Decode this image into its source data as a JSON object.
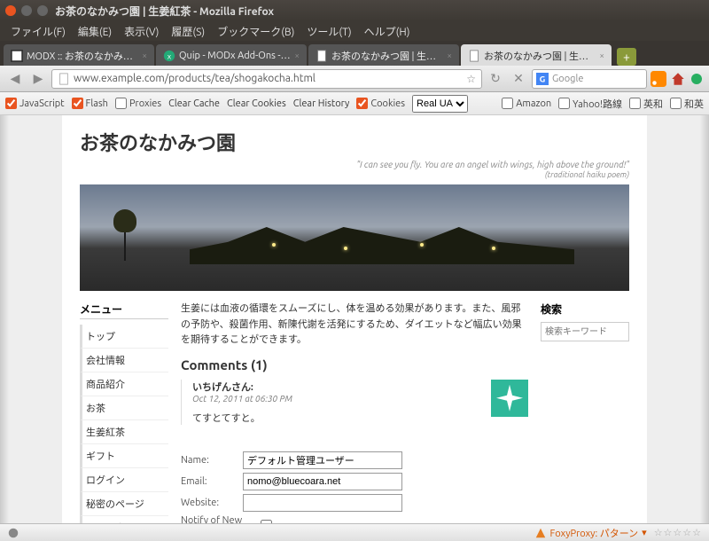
{
  "window": {
    "title": "お茶のなかみつ園 | 生姜紅茶 - Mozilla Firefox"
  },
  "menubar": {
    "file": "ファイル(F)",
    "edit": "編集(E)",
    "view": "表示(V)",
    "history": "履歴(S)",
    "bookmarks": "ブックマーク(B)",
    "tools": "ツール(T)",
    "help": "ヘルプ(H)"
  },
  "tabs": [
    {
      "label": "MODX :: お茶のなかみつ園"
    },
    {
      "label": "Quip - MODx Add-Ons - MO..."
    },
    {
      "label": "お茶のなかみつ園 | 生姜紅茶"
    },
    {
      "label": "お茶のなかみつ園 | 生姜紅茶",
      "active": true
    }
  ],
  "url": "www.example.com/products/tea/shogakocha.html",
  "search_engine": "Google",
  "toolbar": {
    "javascript": "JavaScript",
    "flash": "Flash",
    "proxies": "Proxies",
    "clear_cache": "Clear Cache",
    "clear_cookies": "Clear Cookies",
    "clear_history": "Clear History",
    "cookies": "Cookies",
    "ua": "Real UA",
    "amazon": "Amazon",
    "yahoo": "Yahoo!路線",
    "eiwa": "英和",
    "waei": "和英"
  },
  "site": {
    "title": "お茶のなかみつ園",
    "quote": "\"I can see you fly. You are an angel with wings, high above the ground!\"",
    "quote_sub": "(traditional haiku poem)"
  },
  "menu": {
    "heading": "メニュー",
    "items": [
      "トップ",
      "会社情報",
      "商品紹介",
      "お茶",
      "生姜紅茶",
      "ギフト",
      "ログイン",
      "秘密のページ",
      "お問い合わせ"
    ]
  },
  "article": {
    "desc": "生姜には血液の循環をスムーズにし、体を温める効果があります。また、風邪の予防や、殺菌作用、新陳代謝を活発にするため、ダイエットなど幅広い効果を期待することができます。",
    "comments_heading": "Comments (1)",
    "comment": {
      "author": "いちげんさん:",
      "date": "Oct 12, 2011 at 06:30 PM",
      "body": "てすとてすと。"
    }
  },
  "form": {
    "name_label": "Name:",
    "name_value": "デフォルト管理ユーザー",
    "email_label": "Email:",
    "email_value": "nomo@bluecoara.net",
    "website_label": "Website:",
    "website_value": "",
    "notify_label": "Notify of New Replies:"
  },
  "search": {
    "heading": "検索",
    "placeholder": "検索キーワード"
  },
  "status": {
    "foxy": "FoxyProxy: パターン",
    "stars": "☆☆☆☆☆"
  }
}
